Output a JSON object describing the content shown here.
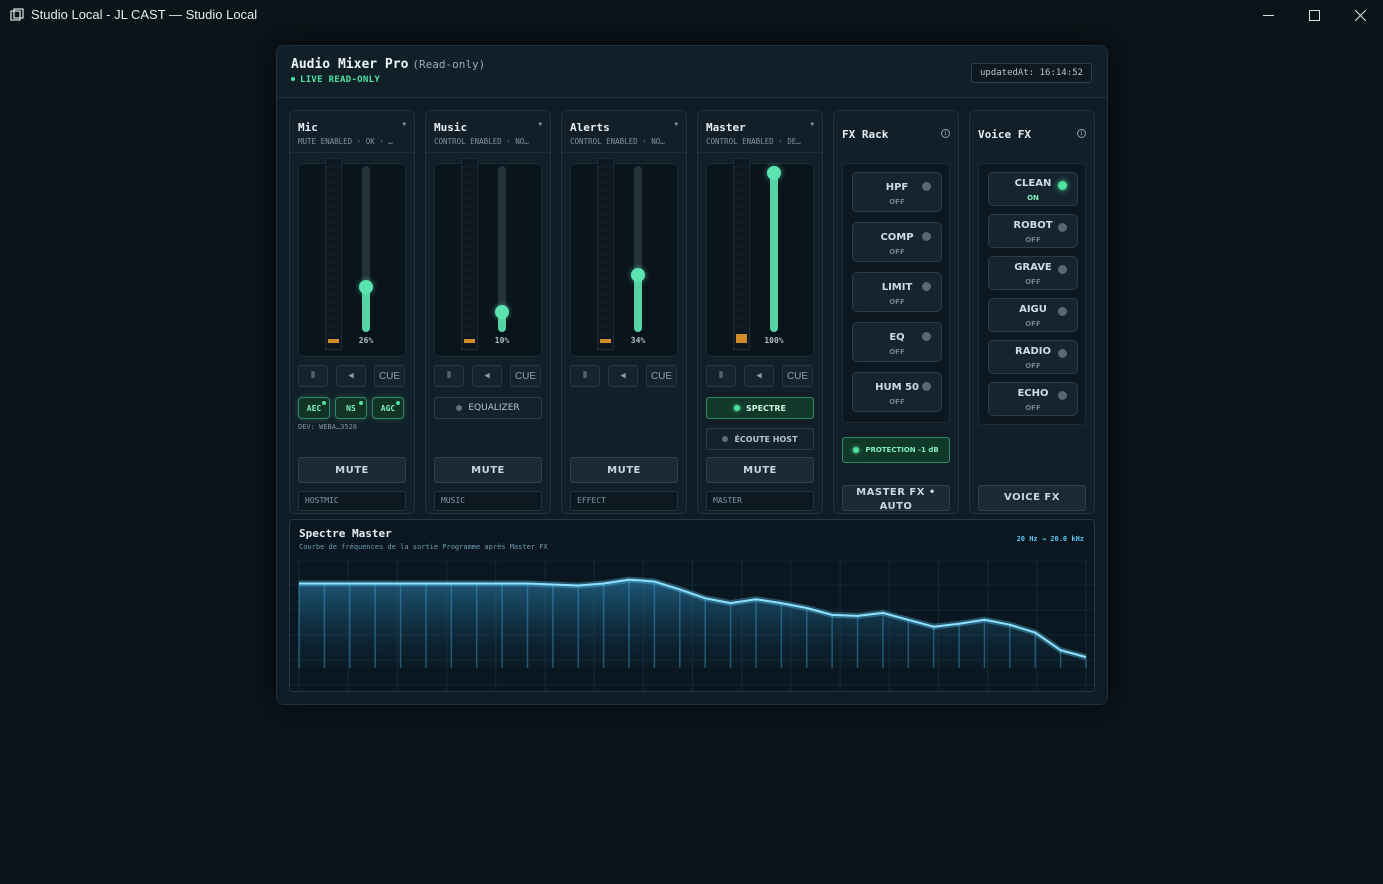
{
  "window": {
    "title": "Studio Local - JL CAST — Studio Local"
  },
  "header": {
    "title": "Audio Mixer Pro",
    "subtitle": "(Read-only)",
    "live": "LIVE READ-ONLY",
    "updated": "updatedAt: 16:14:52"
  },
  "channels": [
    {
      "name": "Mic",
      "status": "MUTE ENABLED · OK · …",
      "level_pct": 26,
      "meter_level": 0.02,
      "pct_label": "26%",
      "cue": "CUE",
      "mute": "MUTE",
      "io": "HOSTMIC",
      "toggles": [
        "AEC",
        "NS",
        "AGC"
      ],
      "dev": "DEV: WEBA…3528"
    },
    {
      "name": "Music",
      "status": "CONTROL ENABLED · NO…",
      "level_pct": 10,
      "meter_level": 0.02,
      "pct_label": "10%",
      "cue": "CUE",
      "mute": "MUTE",
      "io": "MUSIC",
      "equalizer": "EQUALIZER"
    },
    {
      "name": "Alerts",
      "status": "CONTROL ENABLED · NO…",
      "level_pct": 34,
      "meter_level": 0.02,
      "pct_label": "34%",
      "cue": "CUE",
      "mute": "MUTE",
      "io": "EFFECT"
    },
    {
      "name": "Master",
      "status": "CONTROL ENABLED · DE…",
      "level_pct": 100,
      "meter_level": 0.05,
      "pct_label": "100%",
      "cue": "CUE",
      "mute": "MUTE",
      "io": "MASTER",
      "spectre": "SPECTRE",
      "ecoute": "ÉCOUTE HOST"
    }
  ],
  "fx_rack": {
    "title": "FX Rack",
    "items": [
      {
        "label": "HPF",
        "state": "OFF"
      },
      {
        "label": "COMP",
        "state": "OFF"
      },
      {
        "label": "LIMIT",
        "state": "OFF"
      },
      {
        "label": "EQ",
        "state": "OFF"
      },
      {
        "label": "HUM 50",
        "state": "OFF"
      }
    ],
    "protection": "PROTECTION -1 dB",
    "bottom": "MASTER FX • AUTO"
  },
  "voice_fx": {
    "title": "Voice FX",
    "items": [
      {
        "label": "CLEAN",
        "state": "ON",
        "on": true
      },
      {
        "label": "ROBOT",
        "state": "OFF",
        "on": false
      },
      {
        "label": "GRAVE",
        "state": "OFF",
        "on": false
      },
      {
        "label": "AIGU",
        "state": "OFF",
        "on": false
      },
      {
        "label": "RADIO",
        "state": "OFF",
        "on": false
      },
      {
        "label": "ECHO",
        "state": "OFF",
        "on": false
      }
    ],
    "bottom": "VOICE FX"
  },
  "spectrum": {
    "title": "Spectre Master",
    "subtitle": "Courbe de fréquences de la sortie Programme après Master FX",
    "range": "20 Hz → 20.0 kHz",
    "bands": [
      0.7,
      0.7,
      0.7,
      0.7,
      0.7,
      0.7,
      0.7,
      0.7,
      0.7,
      0.7,
      0.69,
      0.68,
      0.7,
      0.74,
      0.72,
      0.64,
      0.55,
      0.5,
      0.54,
      0.5,
      0.45,
      0.38,
      0.37,
      0.4,
      0.33,
      0.26,
      0.29,
      0.33,
      0.28,
      0.2,
      0.02,
      -0.05
    ]
  },
  "colors": {
    "accent_green": "#4fe39e",
    "fader_green": "#55d3a4",
    "spectrum_blue": "#5cc8f2",
    "meter_orange": "#d08a2a"
  }
}
